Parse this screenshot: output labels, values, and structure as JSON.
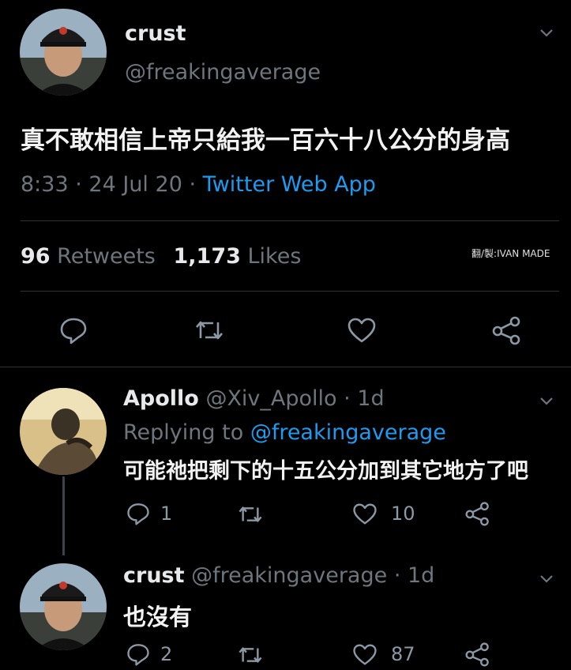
{
  "main_tweet": {
    "display_name": "crust",
    "handle": "@freakingaverage",
    "text": "真不敢相信上帝只給我一百六十八公分的身高",
    "time": "8:33",
    "sep1": "·",
    "date": "24 Jul 20",
    "sep2": "·",
    "source": "Twitter Web App",
    "retweet_count": "96",
    "retweet_label": "Retweets",
    "like_count": "1,173",
    "like_label": "Likes",
    "watermark": "翻/製:IVAN MADE"
  },
  "reply1": {
    "display_name": "Apollo",
    "handle": "@Xiv_Apollo",
    "sep": "·",
    "age": "1d",
    "replying_label": "Replying to",
    "replying_handle": "@freakingaverage",
    "text": "可能祂把剩下的十五公分加到其它地方了吧",
    "reply_count": "1",
    "like_count": "10"
  },
  "reply2": {
    "display_name": "crust",
    "handle": "@freakingaverage",
    "sep": "·",
    "age": "1d",
    "text": "也沒有",
    "reply_count": "2",
    "like_count": "87"
  },
  "colors": {
    "background": "#000000",
    "text": "#e7e9ea",
    "muted": "#6e767d",
    "link": "#1d9bf0",
    "divider": "#2f3336"
  },
  "icons": [
    "chevron-down-icon",
    "reply-icon",
    "retweet-icon",
    "like-icon",
    "share-icon"
  ]
}
